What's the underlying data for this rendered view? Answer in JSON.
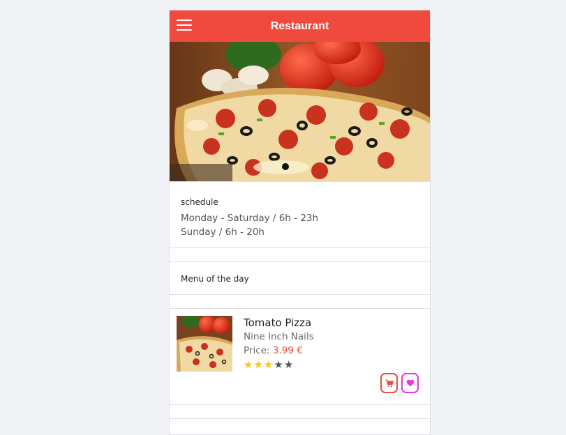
{
  "header": {
    "title": "Restaurant",
    "color": "#f0493e"
  },
  "schedule": {
    "title": "schedule",
    "lines": [
      "Monday - Saturday / 6h - 23h",
      "Sunday / 6h - 20h"
    ]
  },
  "menu_of_day": {
    "title": "Menu of the day"
  },
  "items": [
    {
      "name": "Tomato Pizza",
      "subtitle": "Nine Inch Nails",
      "price_label": "Price: ",
      "price": "3.99 €",
      "rating": 3,
      "rating_max": 5
    }
  ],
  "icons": {
    "menu": "hamburger-menu-icon",
    "cart": "cart-icon",
    "favorite": "heart-icon"
  },
  "colors": {
    "accent": "#f0493e",
    "favorite": "#e536e8",
    "star_on": "#f5c518"
  }
}
